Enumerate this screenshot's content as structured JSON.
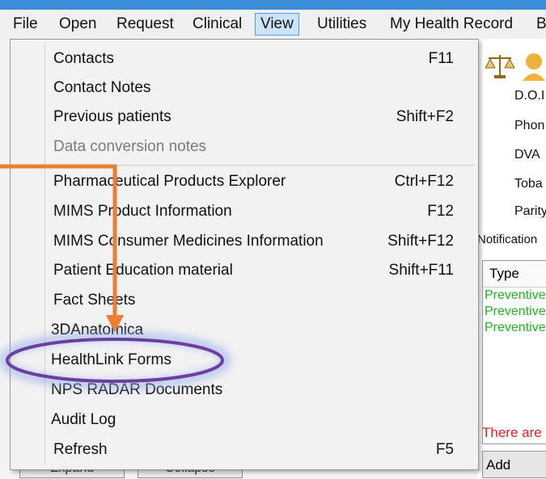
{
  "menubar": {
    "items": [
      "File",
      "Open",
      "Request",
      "Clinical",
      "View",
      "Utilities",
      "My Health Record",
      "B"
    ],
    "active": "View"
  },
  "view_menu": {
    "items": [
      {
        "label": "Contacts",
        "shortcut": "F11",
        "enabled": true
      },
      {
        "label": "Contact Notes",
        "shortcut": "",
        "enabled": true
      },
      {
        "label": "Previous patients",
        "shortcut": "Shift+F2",
        "enabled": true
      },
      {
        "label": "Data conversion notes",
        "shortcut": "",
        "enabled": false
      },
      {
        "label": "Pharmaceutical Products Explorer",
        "shortcut": "Ctrl+F12",
        "enabled": true
      },
      {
        "label": "MIMS Product Information",
        "shortcut": "F12",
        "enabled": true
      },
      {
        "label": "MIMS Consumer Medicines Information",
        "shortcut": "Shift+F12",
        "enabled": true
      },
      {
        "label": "Patient Education material",
        "shortcut": "Shift+F11",
        "enabled": true
      },
      {
        "label": "Fact Sheets",
        "shortcut": "",
        "enabled": true
      },
      {
        "label": "3DAnatomica",
        "shortcut": "",
        "enabled": true
      },
      {
        "label": "HealthLink Forms",
        "shortcut": "",
        "enabled": true,
        "highlighted": true
      },
      {
        "label": "NPS RADAR Documents",
        "shortcut": "",
        "enabled": true
      },
      {
        "label": "Audit Log",
        "shortcut": "",
        "enabled": true
      },
      {
        "label": "Refresh",
        "shortcut": "F5",
        "enabled": true
      }
    ]
  },
  "background": {
    "right_labels": [
      "D.O.I",
      "Phon",
      "DVA",
      "Toba",
      "Parity"
    ],
    "notifications_label": "Notification",
    "grid_header": "Type",
    "grid_rows": [
      "Preventive",
      "Preventive",
      "Preventive"
    ],
    "warning_text": "There are",
    "add_button": "Add",
    "bottom_buttons": [
      "Expand",
      "Collapse"
    ]
  },
  "colors": {
    "arrow": "#ed7d31",
    "highlight_ellipse": "#6a3fa0",
    "menu_active_bg": "#cce4f7",
    "title_strip": "#3c8ed6"
  }
}
